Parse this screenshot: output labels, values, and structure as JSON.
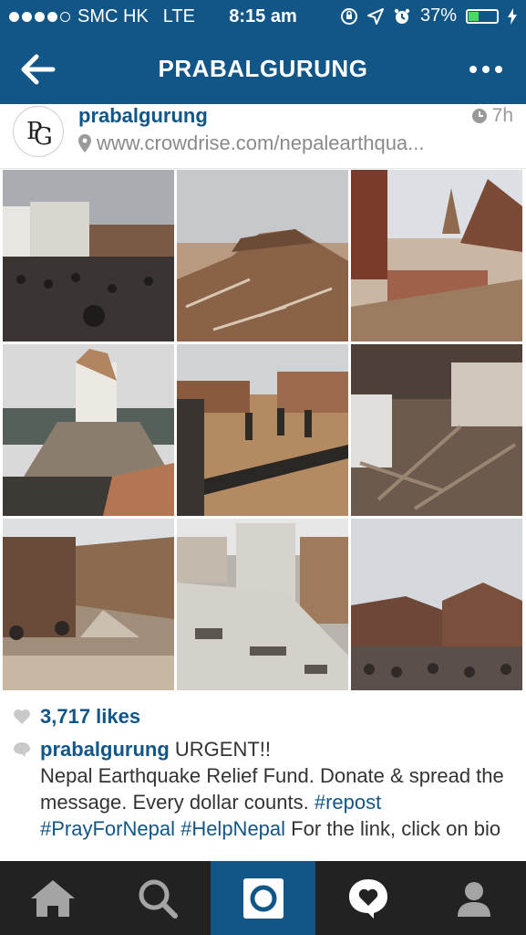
{
  "status_bar": {
    "carrier": "SMC HK",
    "network": "LTE",
    "time": "8:15 am",
    "battery_percent": "37%",
    "battery_level": 0.37,
    "signal_bars": 4,
    "signal_total": 5
  },
  "nav": {
    "title": "PRABALGURUNG",
    "back_icon": "back-arrow-icon",
    "more_icon": "more-dots-icon"
  },
  "post": {
    "username": "prabalgurung",
    "location": "www.crowdrise.com/nepalearthqua...",
    "time_ago": "7h",
    "likes": "3,717 likes",
    "caption_user": "prabalgurung",
    "caption_first": "URGENT!!",
    "caption_body": "Nepal Earthquake Relief Fund. Donate & spread the message. Every dollar counts.",
    "tags": [
      "#repost",
      "#PrayForNepal",
      "#HelpNepal"
    ],
    "caption_tail": "For the",
    "caption_cut": "link, click on bio"
  },
  "tabs": [
    {
      "name": "home",
      "icon": "home-icon"
    },
    {
      "name": "search",
      "icon": "search-icon"
    },
    {
      "name": "camera",
      "icon": "camera-icon"
    },
    {
      "name": "activity",
      "icon": "heart-bubble-icon"
    },
    {
      "name": "profile",
      "icon": "profile-icon"
    }
  ],
  "colors": {
    "brand": "#125688",
    "tabbar": "#222222",
    "battery": "#4cd964"
  }
}
